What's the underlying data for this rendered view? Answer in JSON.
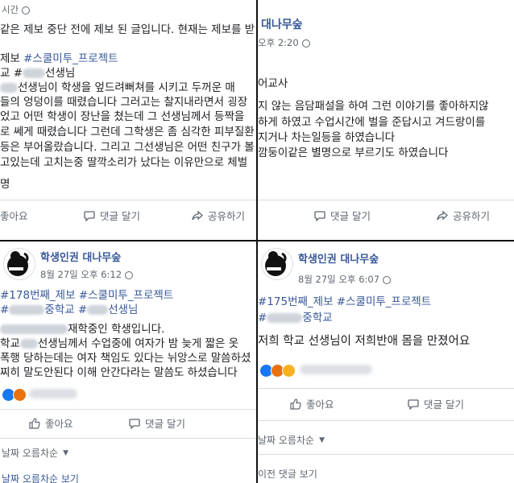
{
  "p1": {
    "time": "시간",
    "lines": [
      "같은 제보 중단 전에 제보 된 글입니다. 현재는 제보를 받",
      "#스쿨미투_프로젝트",
      "교 #",
      "선생님",
      "선생님이 학생을 엎드려뻐쳐를 시키고 두꺼운 매",
      "들의 엉덩이를 때렸습니다 그러고는 찰지내라면서 굉장",
      "었고 어떤 학생이 장난을 쳤는데 그 선생님께서 등짝을",
      "로 쎄게 때렸습니다 그런데 그학생은 좀 심각한 피부질환",
      "등은 부어올랐습니다. 그리고 그선생님은 어떤 친구가 볼",
      "고있는데 고치는중 딸깍소리가 났다는 이유만으로 체벌",
      "명"
    ],
    "tag_prefix": "제보",
    "like": "좋아요",
    "comment": "댓글 달기",
    "share": "공유하기"
  },
  "p2": {
    "name": "대나무숲",
    "time": "오후 2:20",
    "lines": [
      "어교사",
      "지 않는 음담패설을 하여 그런 이야기를 좋아하지않",
      "하게 하였고 수업시간에 벌을 준답시고 겨드랑이를",
      "지거나 차는일등을 하였습니다",
      "깜둥이같은 별명으로 부르기도 하였습니다"
    ],
    "comment": "댓글 달기",
    "share": "공유하기"
  },
  "p3": {
    "name": "학생인권 대나무숲",
    "time": "8월 27일 오후 6:12",
    "lines": [
      "#178번째_제보 #스쿨미투_프로젝트",
      "#",
      "중학교 #",
      "선생님",
      "재학중인 학생입니다.",
      "학교",
      "선생님께서 수업중에 여자가 밤 늦게 짧은 옷",
      "폭행 당하는데는 여자 책임도 있다는 뉘앙스로 말씀하셨",
      "찌히 말도안된다 이해 안간다라는 말씀도 하셨습니다"
    ],
    "like": "좋아요",
    "comment": "댓글 달기",
    "sort": "날짜 오름차순",
    "more": "날짜 오름차순 보기"
  },
  "p4": {
    "name": "학생인권 대나무숲",
    "time": "8월 27일 오후 6:07",
    "lines": [
      "#175번째_제보 #스쿨미투_프로젝트",
      "#",
      "중학교",
      "저희 학교 선생님이 저희반애 몸을 만졌어요"
    ],
    "like": "좋아요",
    "comment": "댓글 달기",
    "sort": "날짜 오름차순",
    "more": "이전 댓글 보기"
  }
}
